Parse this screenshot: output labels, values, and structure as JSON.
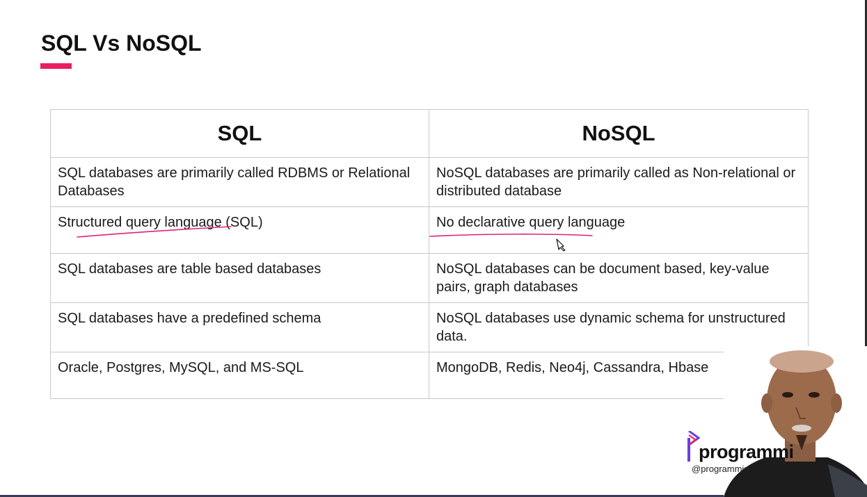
{
  "slide": {
    "title": "SQL Vs NoSQL",
    "accent_color": "#e91e63"
  },
  "table": {
    "headers": [
      "SQL",
      "NoSQL"
    ],
    "rows": [
      [
        "SQL databases are primarily called RDBMS or Relational Databases",
        "NoSQL databases are primarily called as Non-relational or distributed database"
      ],
      [
        "Structured query language (SQL)",
        "No declarative query language"
      ],
      [
        "SQL databases are table based databases",
        "NoSQL databases can be document based, key-value pairs, graph databases"
      ],
      [
        "SQL databases have a predefined schema",
        "NoSQL databases use dynamic schema for unstructured data."
      ],
      [
        "Oracle, Postgres, MySQL, and MS-SQL",
        "MongoDB, Redis, Neo4j, Cassandra, Hbase"
      ]
    ]
  },
  "annotations": {
    "ink_color": "#e0207a"
  },
  "logo": {
    "text": "programmi",
    "handle": "@programmin"
  },
  "icons": {
    "cursor": "pen-cursor-icon",
    "logo_mark": "play-logo-icon"
  }
}
